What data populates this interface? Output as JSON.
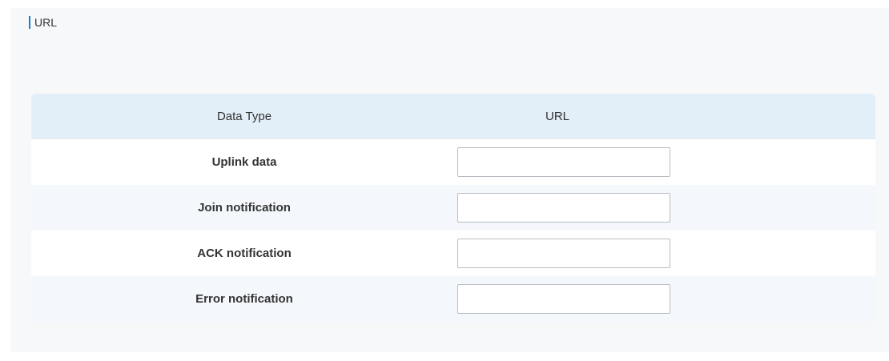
{
  "section": {
    "title": "URL"
  },
  "table": {
    "headers": {
      "data_type": "Data Type",
      "url": "URL"
    },
    "rows": [
      {
        "label": "Uplink data",
        "url_value": ""
      },
      {
        "label": "Join notification",
        "url_value": ""
      },
      {
        "label": "ACK notification",
        "url_value": ""
      },
      {
        "label": "Error notification",
        "url_value": ""
      }
    ]
  },
  "colors": {
    "accent": "#1a7fd4",
    "header_bg": "#e3eff8",
    "alt_row_bg": "#f4f8fc"
  }
}
